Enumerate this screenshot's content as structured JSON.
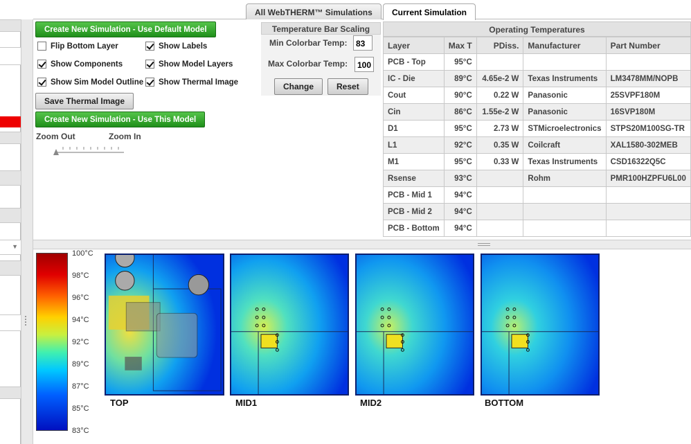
{
  "tabs": [
    {
      "label": "All WebTHERM™ Simulations"
    },
    {
      "label": "Current Simulation"
    }
  ],
  "controls": {
    "create_default": "Create New Simulation - Use Default Model",
    "create_this": "Create New Simulation - Use This Model",
    "save_image": "Save Thermal Image",
    "checkboxes": [
      {
        "label": "Flip Bottom Layer",
        "checked": false
      },
      {
        "label": "Show Labels",
        "checked": true
      },
      {
        "label": "Show Components",
        "checked": true
      },
      {
        "label": "Show Model Layers",
        "checked": true
      },
      {
        "label": "Show Sim Model Outline",
        "checked": true
      },
      {
        "label": "Show Thermal Image",
        "checked": true
      }
    ],
    "zoom_out": "Zoom Out",
    "zoom_in": "Zoom In",
    "zoom_level": 0
  },
  "scaling": {
    "title": "Temperature Bar Scaling",
    "min_label": "Min Colorbar Temp:",
    "min_value": "83",
    "max_label": "Max Colorbar Temp:",
    "max_value": "100",
    "change": "Change",
    "reset": "Reset"
  },
  "operating": {
    "title": "Operating Temperatures",
    "columns": [
      "Layer",
      "Max T",
      "PDiss.",
      "Manufacturer",
      "Part Number"
    ],
    "rows": [
      {
        "layer": "PCB - Top",
        "max": "95°C",
        "pdiss": "",
        "mfr": "",
        "part": ""
      },
      {
        "layer": "IC - Die",
        "max": "89°C",
        "pdiss": "4.65e-2 W",
        "mfr": "Texas Instruments",
        "part": "LM3478MM/NOPB"
      },
      {
        "layer": "Cout",
        "max": "90°C",
        "pdiss": "0.22 W",
        "mfr": "Panasonic",
        "part": "25SVPF180M"
      },
      {
        "layer": "Cin",
        "max": "86°C",
        "pdiss": "1.55e-2 W",
        "mfr": "Panasonic",
        "part": "16SVP180M"
      },
      {
        "layer": "D1",
        "max": "95°C",
        "pdiss": "2.73 W",
        "mfr": "STMicroelectronics",
        "part": "STPS20M100SG-TR"
      },
      {
        "layer": "L1",
        "max": "92°C",
        "pdiss": "0.35 W",
        "mfr": "Coilcraft",
        "part": "XAL1580-302MEB"
      },
      {
        "layer": "M1",
        "max": "95°C",
        "pdiss": "0.33 W",
        "mfr": "Texas Instruments",
        "part": "CSD16322Q5C"
      },
      {
        "layer": "Rsense",
        "max": "93°C",
        "pdiss": "",
        "mfr": "Rohm",
        "part": "PMR100HZPFU6L00"
      },
      {
        "layer": "PCB - Mid 1",
        "max": "94°C",
        "pdiss": "",
        "mfr": "",
        "part": ""
      },
      {
        "layer": "PCB - Mid 2",
        "max": "94°C",
        "pdiss": "",
        "mfr": "",
        "part": ""
      },
      {
        "layer": "PCB - Bottom",
        "max": "94°C",
        "pdiss": "",
        "mfr": "",
        "part": ""
      }
    ]
  },
  "colorbar": {
    "labels": [
      "100°C",
      "98°C",
      "96°C",
      "94°C",
      "92°C",
      "89°C",
      "87°C",
      "85°C",
      "83°C"
    ]
  },
  "boards": [
    {
      "label": "TOP"
    },
    {
      "label": "MID1"
    },
    {
      "label": "MID2"
    },
    {
      "label": "BOTTOM"
    }
  ],
  "colors": {
    "accent_green": "#2a9d22",
    "tab_border": "#aaaaaa",
    "left_red": "#ee0000"
  }
}
